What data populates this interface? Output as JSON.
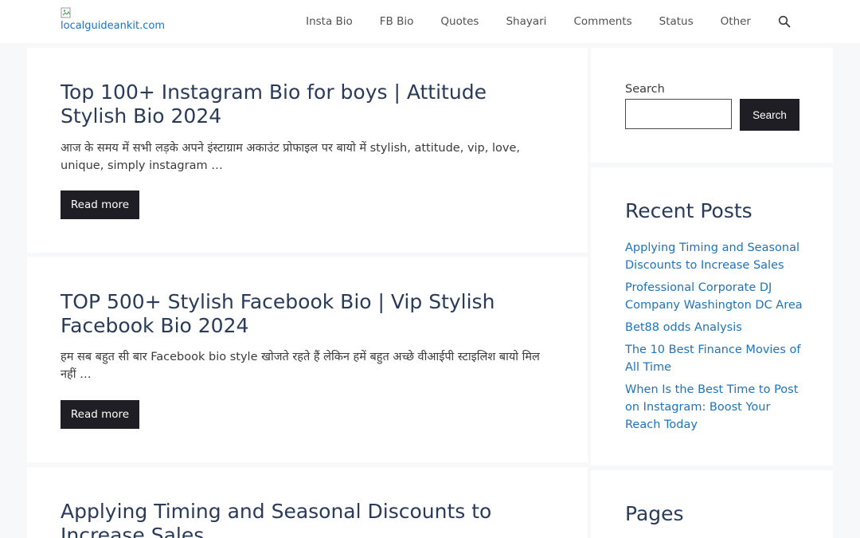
{
  "header": {
    "logo_alt": "localguideankit.com",
    "nav": [
      "Insta Bio",
      "FB Bio",
      "Quotes",
      "Shayari",
      "Comments",
      "Status",
      "Other"
    ]
  },
  "articles": [
    {
      "title": "Top 100+ Instagram Bio for boys | Attitude Stylish Bio 2024",
      "excerpt": "आज के समय में सभी लड़के अपने इंस्टाग्राम अकाउंट प्रोफाइल पर बायो में stylish, attitude, vip, love, unique, simply instagram …",
      "read_more": "Read more"
    },
    {
      "title": "TOP 500+ Stylish Facebook Bio | Vip Stylish Facebook Bio 2024",
      "excerpt": "हम सब बहुत सी बार Facebook bio style खोजते रहते हैं लेकिन हमें बहुत अच्छे वीआईपी स्टाइलिश बायो मिल नहीं …",
      "read_more": "Read more"
    },
    {
      "title": "Applying Timing and Seasonal Discounts to Increase Sales"
    }
  ],
  "sidebar": {
    "search_label": "Search",
    "search_button": "Search",
    "recent_posts_title": "Recent Posts",
    "recent_posts": [
      "Applying Timing and Seasonal Discounts to Increase Sales",
      "Professional Corporate DJ Company Washington DC Area",
      "Bet88 odds Analysis",
      "The 10 Best Finance Movies of All Time",
      "When Is the Best Time to Post on Instagram: Boost Your Reach Today"
    ],
    "pages_title": "Pages"
  },
  "colors": {
    "background": "#f7f8f9",
    "title": "#2a3b5a",
    "link": "#1e73be",
    "button": "#1f1e24"
  },
  "icons": {
    "search_toggle": "search-icon",
    "broken_image": "broken-image-icon"
  }
}
